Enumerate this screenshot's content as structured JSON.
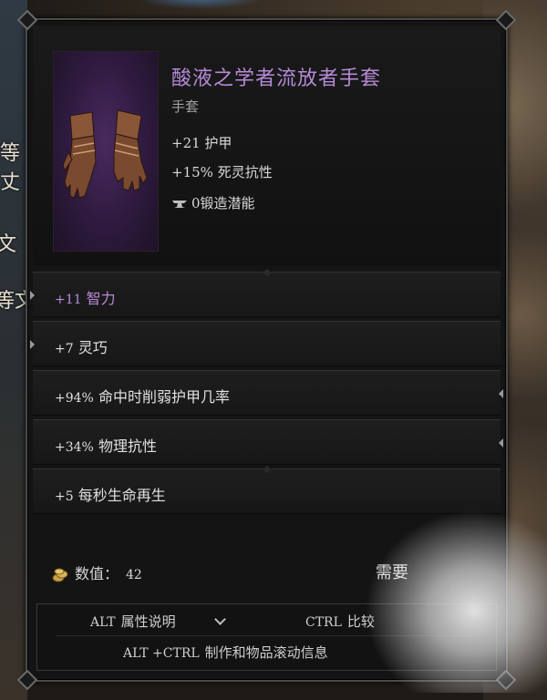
{
  "tooltip": {
    "item_name": "酸液之学者流放者手套",
    "item_type": "手套",
    "base_stats": [
      {
        "num": "+21",
        "text": "护甲"
      },
      {
        "num": "+15%",
        "text": "死灵抗性"
      }
    ],
    "forge": {
      "num": "0",
      "text": "锻造潜能"
    },
    "affixes": [
      {
        "num": "+11",
        "text": "智力",
        "color": "#b78ad8"
      },
      {
        "num": "+7",
        "text": "灵巧",
        "color": "#e0e0e0"
      },
      {
        "num": "+94%",
        "text": "命中时削弱护甲几率",
        "color": "#e0e0e0"
      },
      {
        "num": "+34%",
        "text": "物理抗性",
        "color": "#e0e0e0"
      },
      {
        "num": "+5",
        "text": "每秒生命再生",
        "color": "#e0e0e0"
      }
    ],
    "value_label": "数值：",
    "value": "42",
    "require_label": "需要",
    "footer": {
      "alt_key": "ALT",
      "alt_text": "属性说明",
      "ctrl_key": "CTRL",
      "ctrl_text": "比较",
      "combo_key": "ALT +CTRL",
      "combo_text": "制作和物品滚动信息"
    }
  },
  "background": {
    "left_chars": [
      "等",
      "丈",
      "文",
      "等文"
    ]
  },
  "colors": {
    "item_name": "#b78ad8",
    "panel": "#141414",
    "text": "#d8d8d8"
  }
}
